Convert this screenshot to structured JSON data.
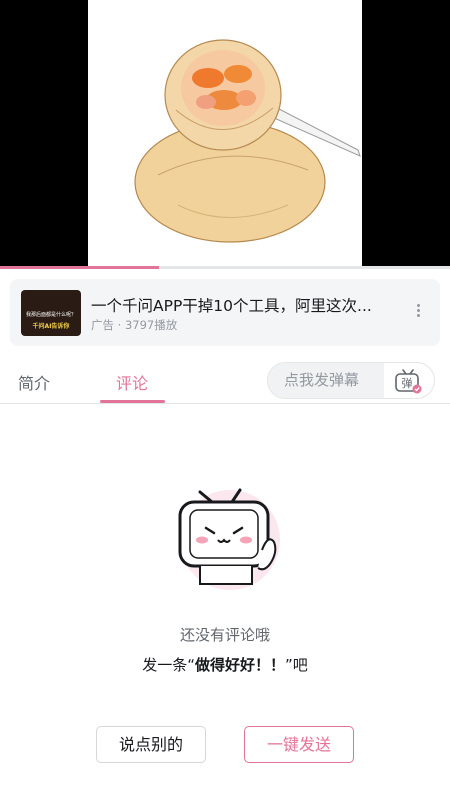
{
  "video": {
    "progress": 0.354
  },
  "ad": {
    "thumb_text_line1": "我那后面都是什么呢？",
    "thumb_text_line2": "千问AI告诉你",
    "title": "一个千问APP干掉10个工具，阿里这次...",
    "meta": "广告 · 3797播放",
    "more_icon": "more-vertical-icon"
  },
  "tabs": {
    "intro_label": "简介",
    "comments_label": "评论",
    "active_color": "#e37499"
  },
  "danmu": {
    "placeholder": "点我发弹幕",
    "icon_label": "弹",
    "icon": "danmu-toggle-icon"
  },
  "empty_state": {
    "line1": "还没有评论哦",
    "line2_prefix": "发一条“",
    "line2_emphasis": "做得好好！！",
    "line2_suffix": "”吧",
    "illustration": "tv-mascot-waving"
  },
  "buttons": {
    "other_label": "说点别的",
    "send_label": "一键发送"
  },
  "colors": {
    "accent": "#e37499",
    "text_secondary": "#61666d",
    "text_muted": "#9499a0"
  }
}
